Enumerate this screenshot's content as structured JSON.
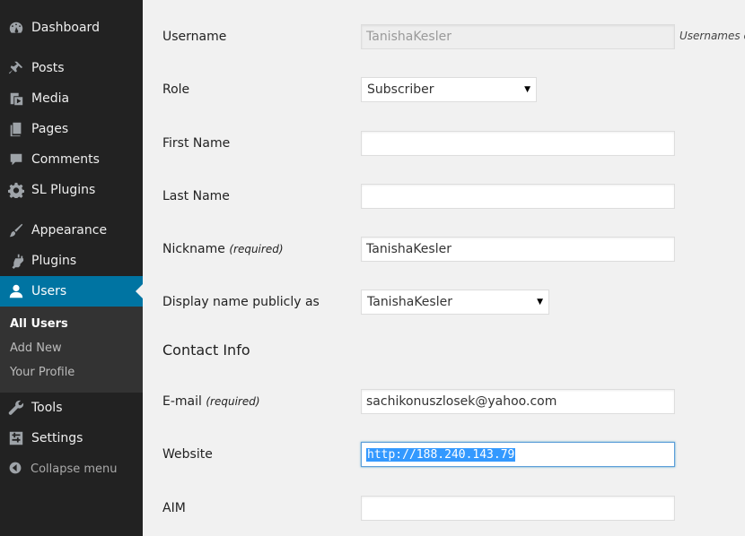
{
  "sidebar": {
    "items": [
      {
        "name": "dashboard",
        "label": "Dashboard",
        "icon": "dashboard-icon"
      },
      {
        "name": "posts",
        "label": "Posts",
        "icon": "pin-icon"
      },
      {
        "name": "media",
        "label": "Media",
        "icon": "media-icon"
      },
      {
        "name": "pages",
        "label": "Pages",
        "icon": "pages-icon"
      },
      {
        "name": "comments",
        "label": "Comments",
        "icon": "comment-icon"
      },
      {
        "name": "sl-plugins",
        "label": "SL Plugins",
        "icon": "gear-icon"
      },
      {
        "name": "appearance",
        "label": "Appearance",
        "icon": "brush-icon"
      },
      {
        "name": "plugins",
        "label": "Plugins",
        "icon": "plug-icon"
      },
      {
        "name": "users",
        "label": "Users",
        "icon": "user-icon"
      },
      {
        "name": "tools",
        "label": "Tools",
        "icon": "wrench-icon"
      },
      {
        "name": "settings",
        "label": "Settings",
        "icon": "sliders-icon"
      }
    ],
    "submenu": [
      "All Users",
      "Add New",
      "Your Profile"
    ],
    "collapse_label": "Collapse menu",
    "active_color": "#0074a2"
  },
  "form": {
    "username_label": "Username",
    "username_value": "TanishaKesler",
    "username_hint": "Usernames c",
    "role_label": "Role",
    "role_value": "Subscriber",
    "first_name_label": "First Name",
    "first_name_value": "",
    "last_name_label": "Last Name",
    "last_name_value": "",
    "nickname_label": "Nickname",
    "nickname_required": "(required)",
    "nickname_value": "TanishaKesler",
    "display_name_label": "Display name publicly as",
    "display_name_value": "TanishaKesler",
    "contact_title": "Contact Info",
    "email_label": "E-mail",
    "email_required": "(required)",
    "email_value": "sachikonuszlosek@yahoo.com",
    "website_label": "Website",
    "website_value": "http://188.240.143.79",
    "aim_label": "AIM",
    "aim_value": ""
  }
}
